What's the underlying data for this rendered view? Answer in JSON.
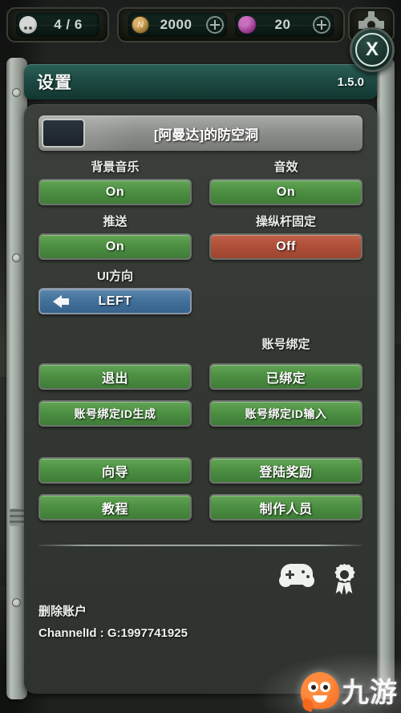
{
  "hud": {
    "population": {
      "icon": "skull-icon",
      "value": "4 / 6"
    },
    "coins": {
      "icon": "coin-icon",
      "value": "2000",
      "add_label": "+"
    },
    "gems": {
      "icon": "gem-icon",
      "value": "20",
      "add_label": "+"
    },
    "settings_icon": "gear-icon"
  },
  "close_button": {
    "label": "X",
    "name": "close-icon"
  },
  "window": {
    "title": "设置",
    "version": "1.5.0"
  },
  "nameplate": {
    "label": "[阿曼达]的防空洞"
  },
  "options": [
    {
      "label": "背景音乐",
      "value": "On",
      "state": "on"
    },
    {
      "label": "音效",
      "value": "On",
      "state": "on"
    },
    {
      "label": "推送",
      "value": "On",
      "state": "on"
    },
    {
      "label": "操纵杆固定",
      "value": "Off",
      "state": "off"
    }
  ],
  "ui_direction": {
    "label": "UI方向",
    "value": "LEFT",
    "arrow": "arrow-left-icon"
  },
  "account": {
    "binding_label": "账号绑定",
    "exit": "退出",
    "bound": "已绑定",
    "generate_id": "账号绑定ID生成",
    "input_id": "账号绑定ID输入"
  },
  "misc": {
    "guide": "向导",
    "login_reward": "登陆奖励",
    "tutorial": "教程",
    "credits": "制作人员"
  },
  "footer": {
    "delete_account": "删除账户",
    "channel_id": "ChannelId : G:1997741925",
    "gamepad_icon": "gamepad-icon",
    "achievement_icon": "achievement-medal-icon"
  },
  "watermark": {
    "text": "九游"
  },
  "colors": {
    "green": "#4c8f42",
    "red": "#b04f38",
    "blue": "#42719b",
    "title_teal": "#1d4a43",
    "panel": "#343833"
  }
}
